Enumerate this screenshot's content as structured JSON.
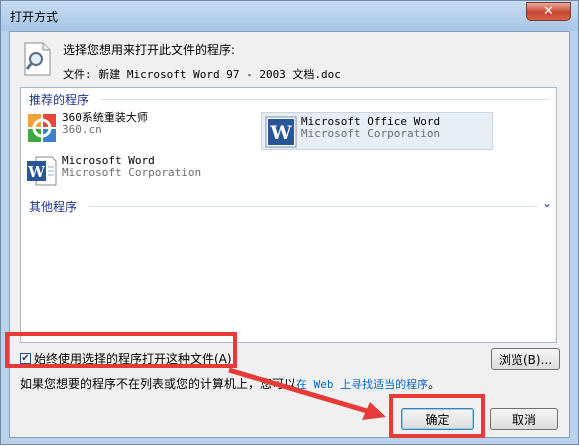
{
  "window": {
    "title": "打开方式"
  },
  "header": {
    "prompt": "选择您想用来打开此文件的程序:",
    "file_label": "文件: 新建 Microsoft Word 97 - 2003 文档.doc"
  },
  "sections": {
    "recommended": "推荐的程序",
    "other": "其他程序"
  },
  "programs": [
    {
      "name": "360系统重装大师",
      "publisher": "360.cn",
      "icon": "360-reinstall-icon"
    },
    {
      "name": "Microsoft Office Word",
      "publisher": "Microsoft Corporation",
      "icon": "word-icon"
    },
    {
      "name": "Microsoft Word",
      "publisher": "Microsoft Corporation",
      "icon": "word-icon"
    }
  ],
  "checkbox": {
    "label": "始终使用选择的程序打开这种文件(A)",
    "checked": true
  },
  "buttons": {
    "browse": "浏览(B)...",
    "ok": "确定",
    "cancel": "取消"
  },
  "help": {
    "prefix": "如果您想要的程序不在列表或您的计算机上，您可以",
    "link": "在 Web 上寻找适当的程序",
    "suffix": "。"
  },
  "colors": {
    "highlight": "#e63b36",
    "link": "#0066cc",
    "section_header": "#1e3287"
  }
}
